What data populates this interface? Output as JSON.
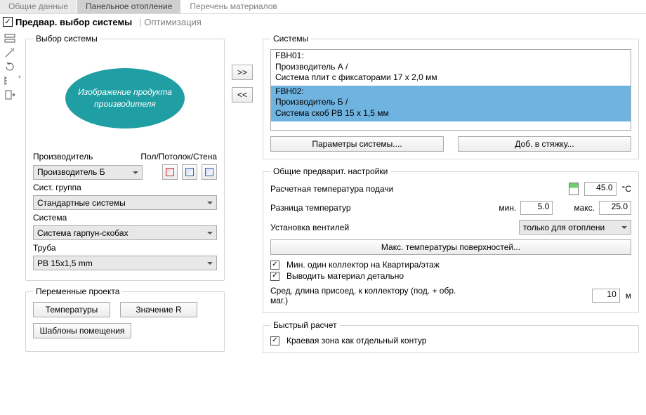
{
  "tabs": {
    "general": "Общие данные",
    "panel": "Панельное отопление",
    "materials": "Перечень материалов"
  },
  "subtabs": {
    "presel": "Предвар. выбор системы",
    "opt": "Оптимизация"
  },
  "sysSelect": {
    "legend": "Выбор системы",
    "image_text": "Изображение продукта производителя",
    "manuf_lbl": "Производитель",
    "mode_lbl": "Пол/Потолок/Стена",
    "manuf_val": "Производитель Б",
    "group_lbl": "Сист. группа",
    "group_val": "Стандартные системы",
    "system_lbl": "Система",
    "system_val": "Система гарпун-скобах",
    "pipe_lbl": "Труба",
    "pipe_val": "PB 15x1,5 mm"
  },
  "vars": {
    "legend": "Переменные проекта",
    "temp": "Температуры",
    "rval": "Значение R",
    "templ": "Шаблоны помещения"
  },
  "systems": {
    "legend": "Системы",
    "items": [
      {
        "code": "FBH01:",
        "manuf": "Производитель А /",
        "desc": "Система плит с фиксаторами 17 x 2,0 мм"
      },
      {
        "code": "FBH02:",
        "manuf": "Производитель Б /",
        "desc": "Система скоб PB 15 x 1,5 мм"
      }
    ],
    "params_btn": "Параметры системы....",
    "add_btn": "Доб. в стяжку..."
  },
  "midbtns": {
    "right": ">>",
    "left": "<<"
  },
  "presets": {
    "legend": "Общие предварит. настройки",
    "supply_lbl": "Расчетная температура подачи",
    "supply_val": "45.0",
    "supply_unit": "°C",
    "dt_lbl": "Разница температур",
    "dt_min_lbl": "мин.",
    "dt_min": "5.0",
    "dt_max_lbl": "макс.",
    "dt_max": "25.0",
    "valve_lbl": "Установка вентилей",
    "valve_val": "только для отоплени",
    "maxtemp_btn": "Макс. температуры поверхностей...",
    "chk1": "Мин. один коллектор на Квартира/этаж",
    "chk2": "Выводить материал детально",
    "len_lbl": "Сред. длина присоед. к коллектору (под. + обр. маг.)",
    "len_val": "10",
    "len_unit": "м"
  },
  "quick": {
    "legend": "Быстрый расчет",
    "chk": "Краевая зона как отдельный контур"
  }
}
